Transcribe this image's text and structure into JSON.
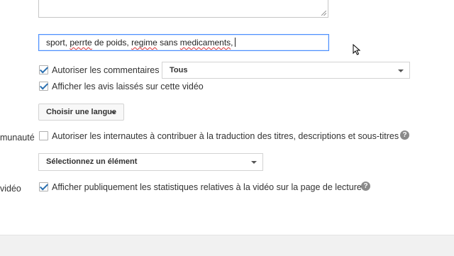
{
  "tags": {
    "segments": [
      {
        "text": "sport, ",
        "misspelled": false
      },
      {
        "text": "perrte",
        "misspelled": true
      },
      {
        "text": " de poids, ",
        "misspelled": false
      },
      {
        "text": "regime",
        "misspelled": true
      },
      {
        "text": " sans ",
        "misspelled": false
      },
      {
        "text": "medicaments",
        "misspelled": true
      },
      {
        "text": ",",
        "misspelled": false
      }
    ]
  },
  "comments": {
    "label": "Autoriser les commentaires",
    "checked": true,
    "select_value": "Tous"
  },
  "ratings": {
    "label": "Afficher les avis laissés sur cette vidéo",
    "checked": true
  },
  "language_button": {
    "label": "Choisir une langue"
  },
  "community": {
    "side_label": "munauté",
    "label": "Autoriser les internautes à contribuer à la traduction des titres, descriptions et sous-titres",
    "checked": false,
    "help": "?",
    "select_value": "Sélectionnez un élément"
  },
  "stats": {
    "side_label": "vidéo",
    "label": "Afficher publiquement les statistiques relatives à la vidéo sur la page de lecture",
    "checked": true,
    "help": "?"
  },
  "colors": {
    "focus_border": "#4d90fe",
    "checkmark": "#2a6fb0",
    "spell_underline": "#dd3333"
  }
}
